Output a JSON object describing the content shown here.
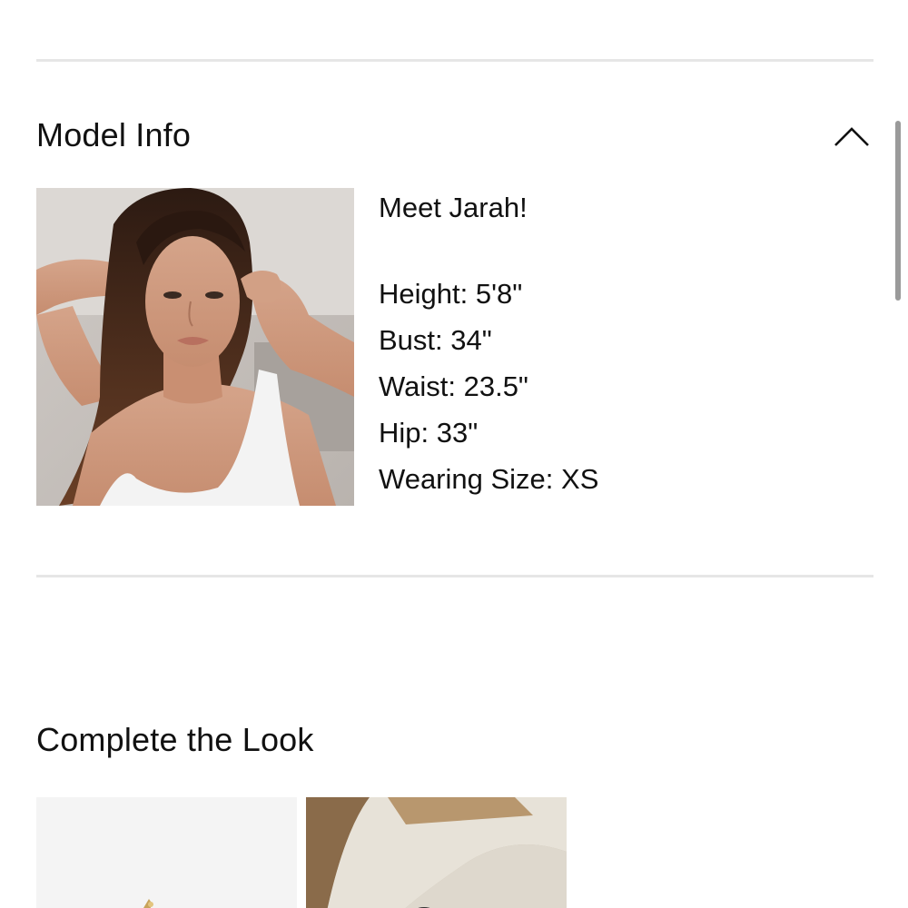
{
  "model_info": {
    "title": "Model Info",
    "toggle_icon": "chevron-up-icon",
    "photo_icon": "model-photo",
    "intro": "Meet Jarah!",
    "stats": [
      {
        "label": "Height",
        "value": "5'8\""
      },
      {
        "label": "Bust",
        "value": "34\""
      },
      {
        "label": "Waist",
        "value": "23.5\""
      },
      {
        "label": "Hip",
        "value": "33\""
      },
      {
        "label": "Wearing Size",
        "value": "XS"
      }
    ]
  },
  "complete_the_look": {
    "title": "Complete the Look",
    "items": [
      {
        "icon": "jewelry-product-image"
      },
      {
        "icon": "textured-bag-product-image"
      }
    ]
  },
  "colors": {
    "divider": "#e6e6e6",
    "text": "#111111",
    "scrollbar": "#9a9a9a"
  }
}
